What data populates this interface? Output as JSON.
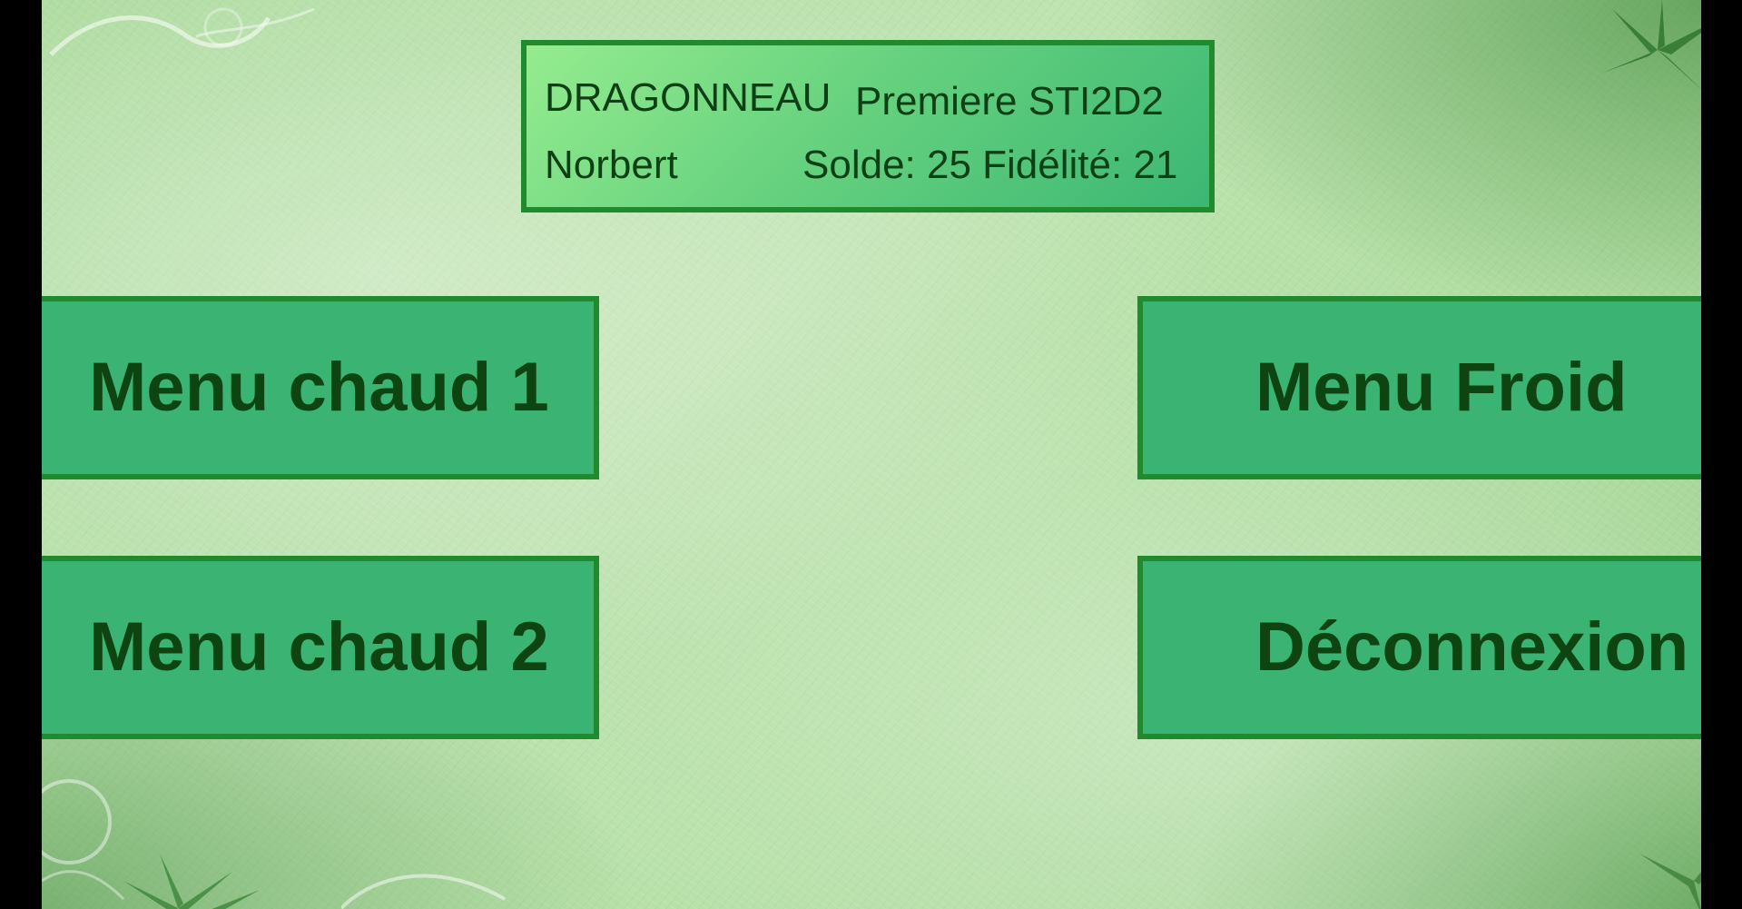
{
  "info_panel": {
    "last_name": "DRAGONNEAU",
    "class_name": "Premiere STI2D2",
    "first_name": "Norbert",
    "balance_text": "Solde: 25 Fidélité: 21"
  },
  "menu": {
    "hot_menu_1": "Menu chaud 1",
    "hot_menu_2": "Menu chaud 2",
    "cold_menu": "Menu Froid",
    "logout": "Déconnexion"
  },
  "colors": {
    "panel_border": "#1f8a2e",
    "button_fill": "#3bb372",
    "text_dark_green": "#0d4411",
    "background_light_green": "#b6e0a7"
  },
  "icons": {
    "decorations": [
      "swirl-ornament-icon",
      "leaf-cluster-icon"
    ]
  }
}
